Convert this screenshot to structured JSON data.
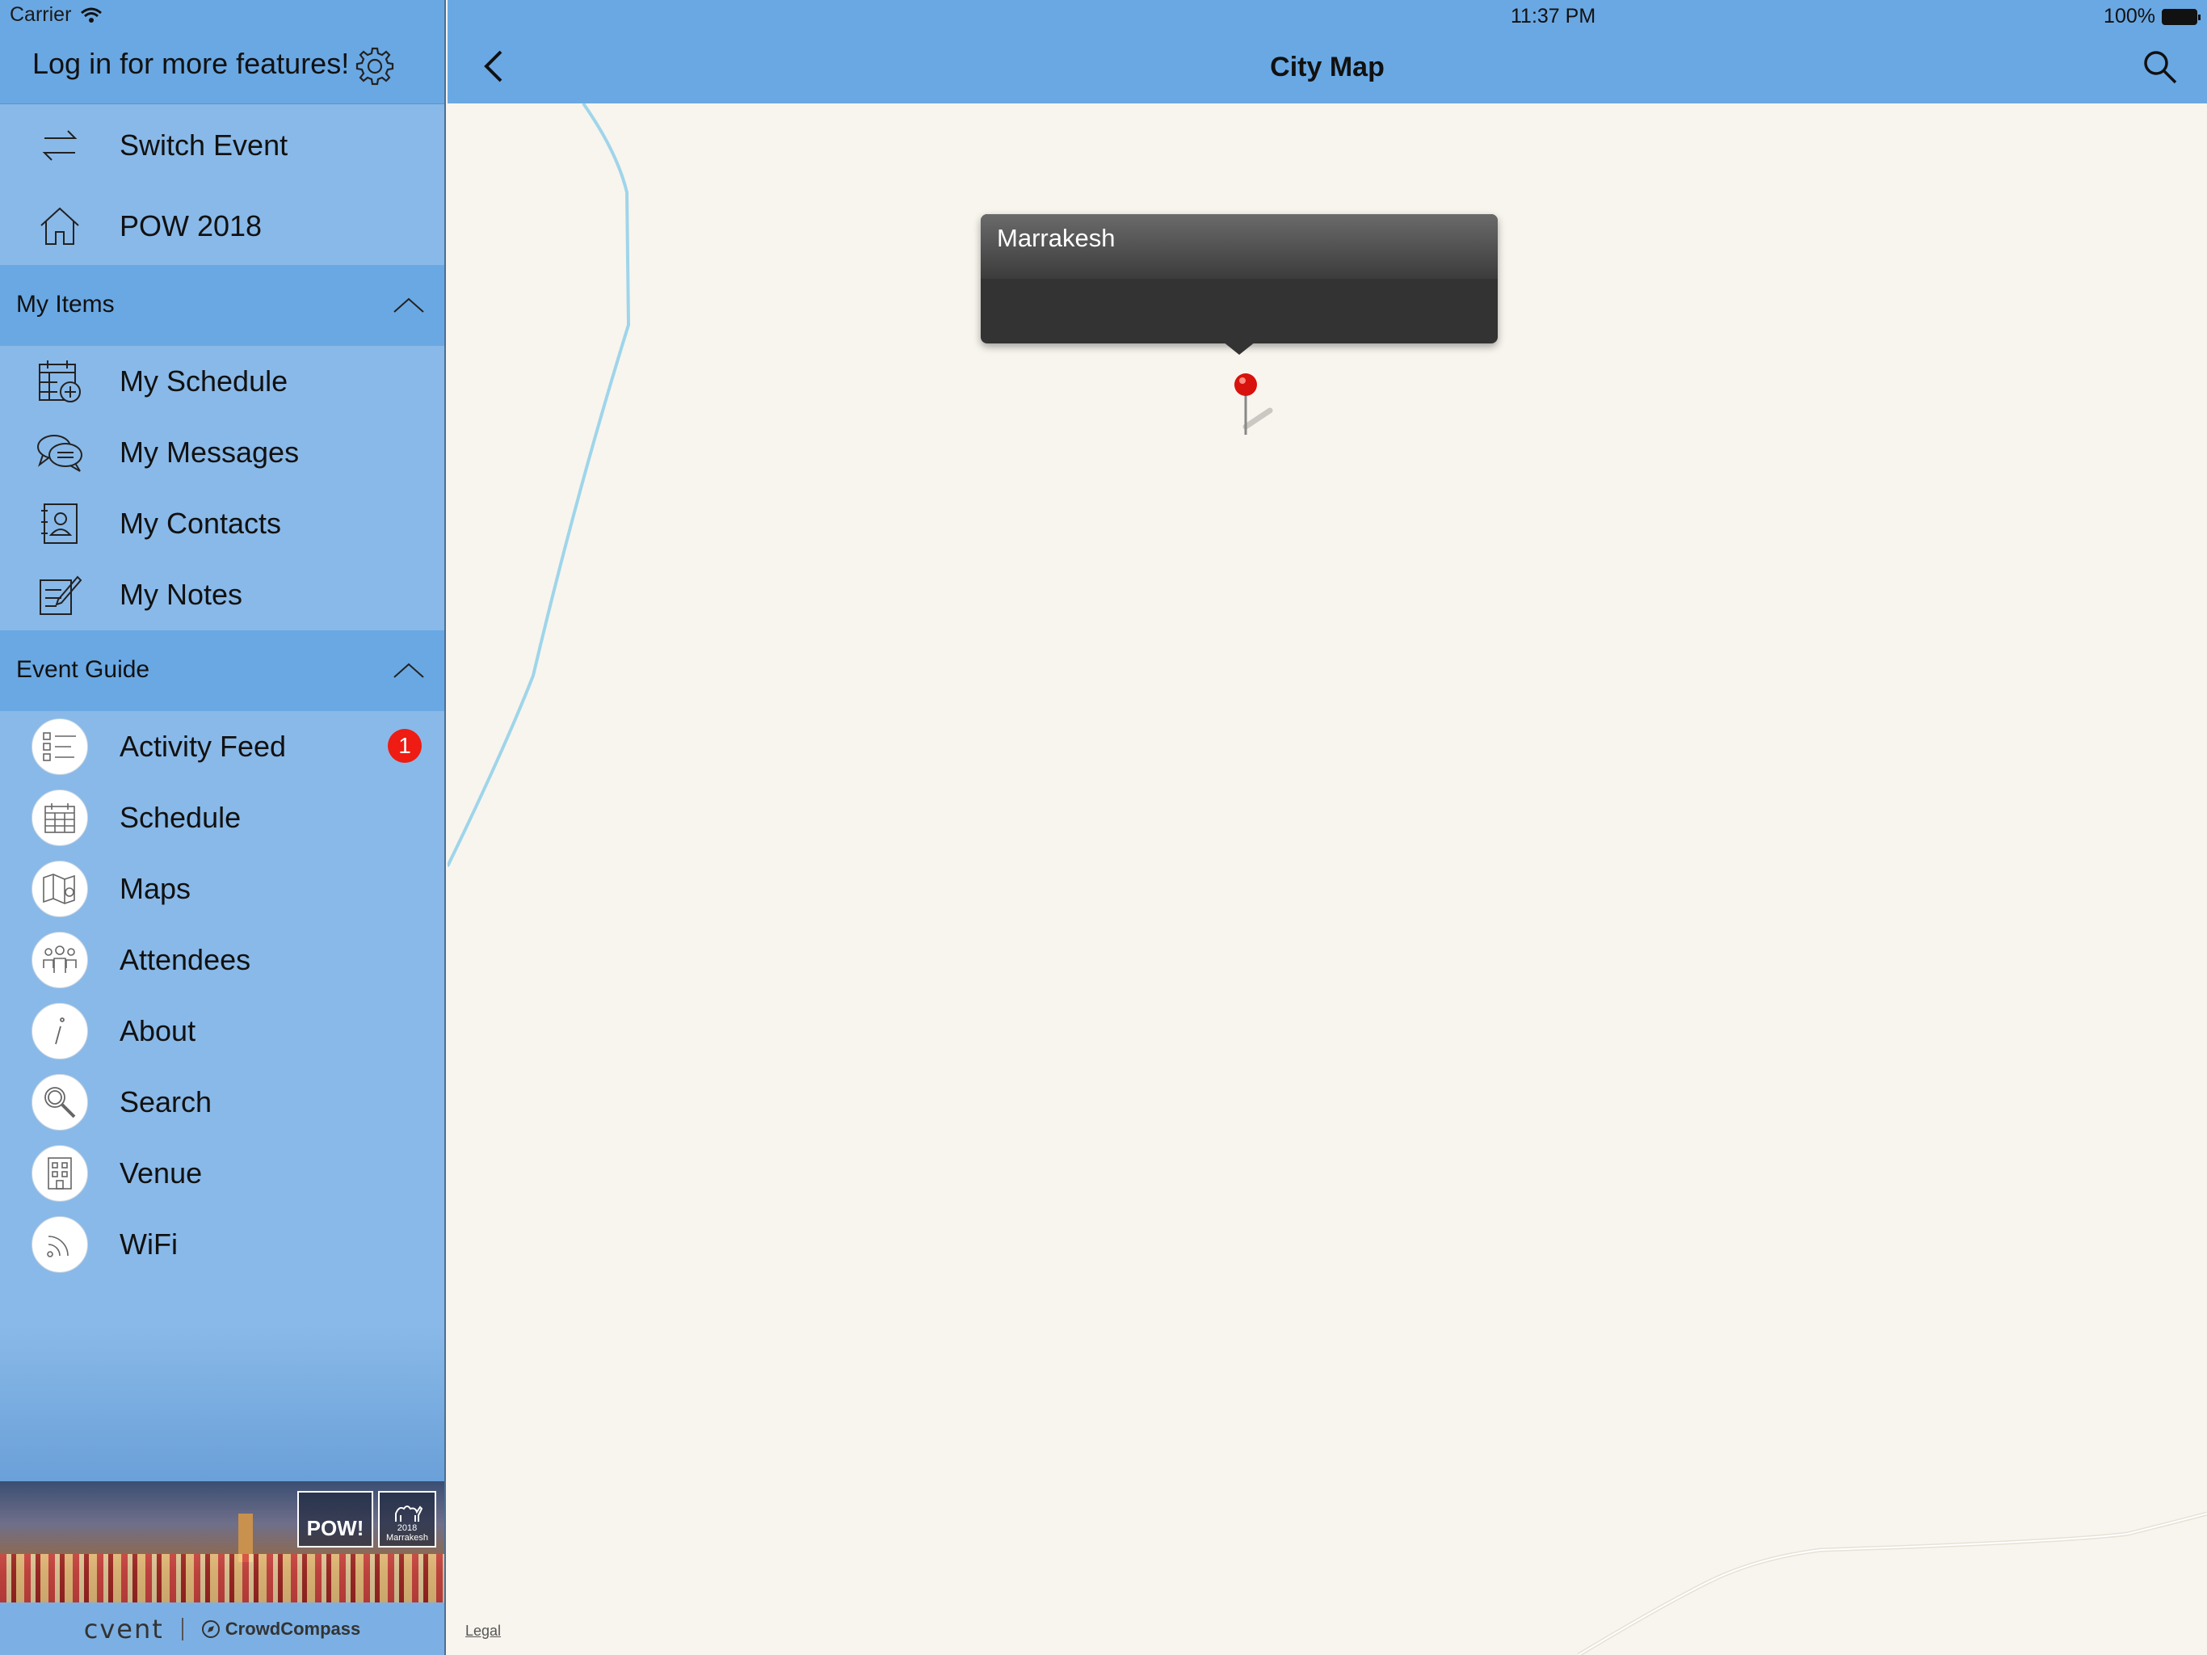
{
  "status": {
    "carrier": "Carrier",
    "time": "11:37 PM",
    "battery": "100%"
  },
  "sidebar": {
    "login_text": "Log in for more features!",
    "top_items": [
      {
        "label": "Switch Event",
        "icon": "switch-icon"
      },
      {
        "label": "POW 2018",
        "icon": "home-icon"
      }
    ],
    "my_items": {
      "header": "My Items",
      "items": [
        {
          "label": "My Schedule",
          "icon": "calendar-add-icon"
        },
        {
          "label": "My Messages",
          "icon": "messages-icon"
        },
        {
          "label": "My Contacts",
          "icon": "contacts-icon"
        },
        {
          "label": "My Notes",
          "icon": "notes-icon"
        }
      ]
    },
    "event_guide": {
      "header": "Event Guide",
      "items": [
        {
          "label": "Activity Feed",
          "icon": "activity-feed-icon",
          "badge": "1"
        },
        {
          "label": "Schedule",
          "icon": "schedule-icon"
        },
        {
          "label": "Maps",
          "icon": "maps-icon"
        },
        {
          "label": "Attendees",
          "icon": "attendees-icon"
        },
        {
          "label": "About",
          "icon": "info-icon"
        },
        {
          "label": "Search",
          "icon": "search-icon"
        },
        {
          "label": "Venue",
          "icon": "venue-icon"
        },
        {
          "label": "WiFi",
          "icon": "wifi-icon"
        }
      ]
    },
    "banner": {
      "pow": "POW!",
      "year": "2018",
      "city": "Marrakesh"
    },
    "footer": {
      "cvent": "cvent",
      "crowdcompass": "CrowdCompass"
    }
  },
  "main": {
    "title": "City Map",
    "callout_title": "Marrakesh",
    "legal": "Legal",
    "toolbar": [
      {
        "icon": "location-pin-icon",
        "color": "#9ccc5a"
      },
      {
        "icon": "bookmark-icon",
        "color": "#b5b5b5"
      },
      {
        "icon": "alarm-icon",
        "color": "#b5b5b5"
      }
    ]
  }
}
